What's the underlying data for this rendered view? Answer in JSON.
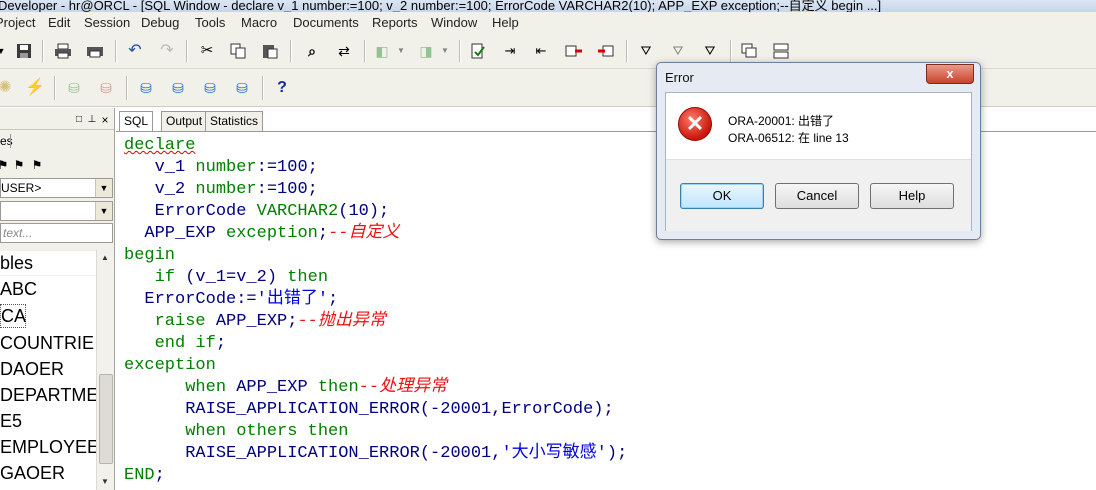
{
  "window": {
    "title": "Developer - hr@ORCL - [SQL Window - declare v_1 number:=100; v_2 number:=100; ErrorCode VARCHAR2(10); APP_EXP exception;--自定义 begin ...]"
  },
  "menu": [
    "Project",
    "Edit",
    "Session",
    "Debug",
    "Tools",
    "Macro",
    "Documents",
    "Reports",
    "Window",
    "Help"
  ],
  "left_panel": {
    "tab_fragment": "es",
    "user_combo": "USER>",
    "filter_combo": "",
    "search_placeholder": "text...",
    "header": "bles",
    "tables": [
      "ABC",
      "CA",
      "COUNTRIE",
      "DAOER",
      "DEPARTMEI",
      "E5",
      "EMPLOYEE",
      "GAOER"
    ],
    "selected_table": "CA"
  },
  "editor": {
    "tabs": [
      "SQL",
      "Output",
      "Statistics"
    ],
    "active_tab": "SQL",
    "lines": [
      [
        {
          "t": "declare",
          "c": "kw"
        }
      ],
      [
        {
          "t": "   v_1 ",
          "c": "id"
        },
        {
          "t": "number",
          "c": "kw"
        },
        {
          "t": ":=100;",
          "c": "id"
        }
      ],
      [
        {
          "t": "   v_2 ",
          "c": "id"
        },
        {
          "t": "number",
          "c": "kw"
        },
        {
          "t": ":=100;",
          "c": "id"
        }
      ],
      [
        {
          "t": "   ErrorCode ",
          "c": "id"
        },
        {
          "t": "VARCHAR2",
          "c": "kw"
        },
        {
          "t": "(10);",
          "c": "id"
        }
      ],
      [
        {
          "t": "  APP_EXP ",
          "c": "id"
        },
        {
          "t": "exception",
          "c": "kw"
        },
        {
          "t": ";",
          "c": "id"
        },
        {
          "t": "--自定义",
          "c": "cm"
        }
      ],
      [
        {
          "t": "begin",
          "c": "kw"
        }
      ],
      [
        {
          "t": "   ",
          "c": "id"
        },
        {
          "t": "if",
          "c": "kw"
        },
        {
          "t": " (v_1=v_2) ",
          "c": "id"
        },
        {
          "t": "then",
          "c": "kw"
        }
      ],
      [
        {
          "t": "  ErrorCode:=",
          "c": "id"
        },
        {
          "t": "'出错了'",
          "c": "st"
        },
        {
          "t": ";",
          "c": "id"
        }
      ],
      [
        {
          "t": "   ",
          "c": "id"
        },
        {
          "t": "raise",
          "c": "kw"
        },
        {
          "t": " APP_EXP;",
          "c": "id"
        },
        {
          "t": "--抛出异常",
          "c": "cm"
        }
      ],
      [
        {
          "t": "   ",
          "c": "id"
        },
        {
          "t": "end if",
          "c": "kw"
        },
        {
          "t": ";",
          "c": "id"
        }
      ],
      [
        {
          "t": "exception",
          "c": "kw"
        }
      ],
      [
        {
          "t": "      ",
          "c": "id"
        },
        {
          "t": "when",
          "c": "kw"
        },
        {
          "t": " APP_EXP ",
          "c": "id"
        },
        {
          "t": "then",
          "c": "kw"
        },
        {
          "t": "--处理异常",
          "c": "cm"
        }
      ],
      [
        {
          "t": "      RAISE_APPLICATION_ERROR(-20001,ErrorCode);",
          "c": "id"
        }
      ],
      [
        {
          "t": "      ",
          "c": "id"
        },
        {
          "t": "when others then",
          "c": "kw"
        }
      ],
      [
        {
          "t": "      RAISE_APPLICATION_ERROR(-20001,",
          "c": "id"
        },
        {
          "t": "'大小写敏感'",
          "c": "st"
        },
        {
          "t": ");",
          "c": "id"
        }
      ],
      [
        {
          "t": "END",
          "c": "kw"
        },
        {
          "t": ";",
          "c": "id"
        }
      ]
    ]
  },
  "dialog": {
    "title": "Error",
    "close_label": "x",
    "icon": "error-x-icon",
    "message_lines": [
      "ORA-20001: 出错了",
      "ORA-06512: 在 line 13"
    ],
    "buttons": {
      "ok": "OK",
      "cancel": "Cancel",
      "help": "Help"
    }
  },
  "icons": {
    "toolbar1": [
      "save-icon",
      "print-icon",
      "print-preview-icon",
      "undo-icon",
      "redo-icon",
      "cut-icon",
      "copy-icon",
      "paste-icon",
      "find-icon",
      "replace-icon",
      "nav-back-icon",
      "nav-forward-icon",
      "execute-icon",
      "indent-icon",
      "unindent-icon",
      "uppercase-icon",
      "lowercase-icon",
      "comment-icon",
      "uncomment-icon",
      "window-list-icon",
      "tile-icon"
    ],
    "toolbar2": [
      "settings-icon",
      "break-icon",
      "commit-icon",
      "rollback-icon",
      "sql-icon",
      "db-icon",
      "explain-icon",
      "help-icon"
    ]
  },
  "colors": {
    "keyword": "#007f00",
    "identifier": "#00007f",
    "comment": "#e11111",
    "string": "#0000e0"
  }
}
